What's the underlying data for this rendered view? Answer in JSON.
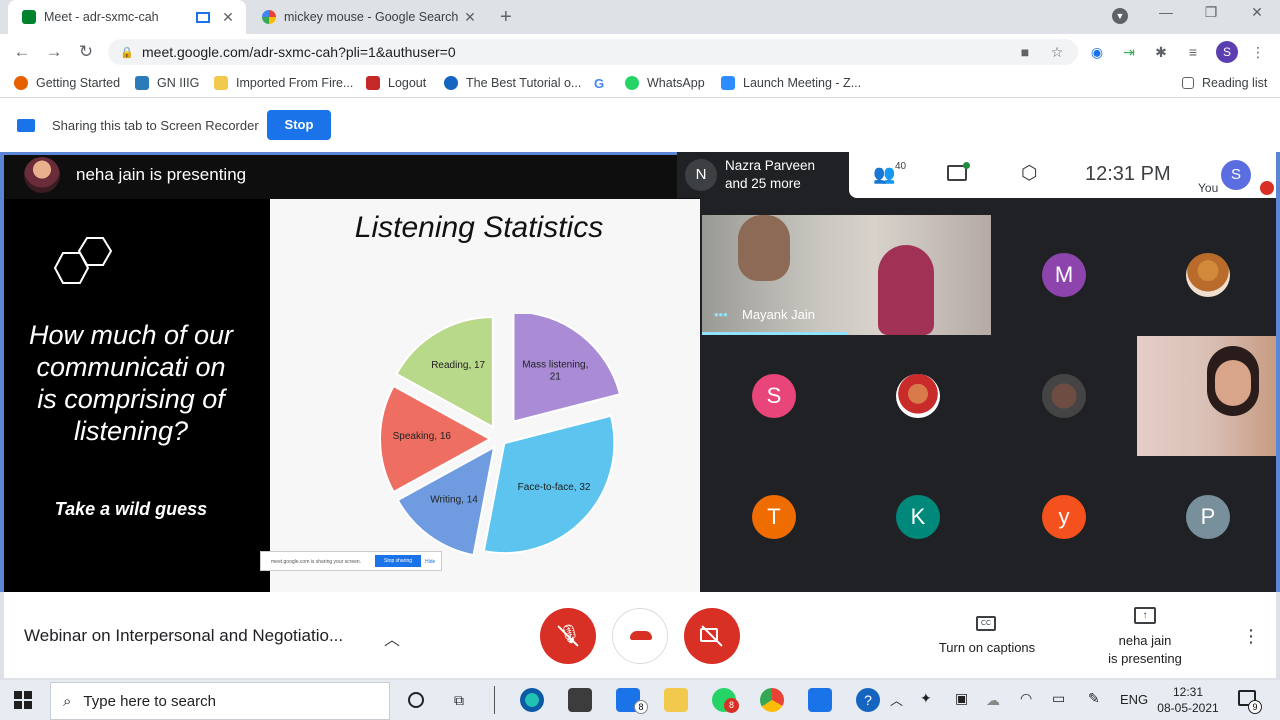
{
  "browser": {
    "tabs": [
      {
        "title": "Meet - adr-sxmc-cah",
        "active": true
      },
      {
        "title": "mickey mouse - Google Search",
        "active": false
      }
    ],
    "url": "meet.google.com/adr-sxmc-cah?pli=1&authuser=0",
    "profile_initial": "S",
    "bookmarks": [
      "Getting Started",
      "GN IIIG",
      "Imported From Fire...",
      "Logout",
      "The Best Tutorial o...",
      "WhatsApp",
      "Launch Meeting - Z..."
    ],
    "reading_list": "Reading list"
  },
  "share_bar": {
    "message": "Sharing this tab to Screen Recorder",
    "stop_label": "Stop"
  },
  "meet": {
    "presenter_banner": "neha jain is presenting",
    "participants_preview": {
      "initial": "N",
      "name": "Nazra Parveen",
      "more": "and 25 more"
    },
    "participant_count": "40",
    "time": "12:31 PM",
    "you_label": "You",
    "you_initial": "S",
    "tiles": {
      "video1_name": "Mayank Jain",
      "avatars": [
        {
          "initial": "M",
          "color": "#8e44ad"
        },
        {
          "initial": "S",
          "color": "#e8457a"
        },
        {
          "initial": "T",
          "color": "#ef6c00"
        },
        {
          "initial": "K",
          "color": "#00897b"
        },
        {
          "initial": "y",
          "color": "#f4511e"
        },
        {
          "initial": "P",
          "color": "#78909c"
        }
      ]
    },
    "slide": {
      "question": "How much of our communicati on is comprising of listening?",
      "tagline": "Take a wild guess",
      "title": "Listening Statistics",
      "share_notice": "meet.google.com is sharing your screen.",
      "share_notice_stop": "Stop sharing",
      "share_notice_hide": "Hide"
    },
    "meeting_title": "Webinar on Interpersonal and Negotiatio...",
    "captions_label": "Turn on captions",
    "presenting_label_1": "neha jain",
    "presenting_label_2": "is presenting"
  },
  "chart_data": {
    "type": "pie",
    "title": "Listening Statistics",
    "categories": [
      "Mass listening",
      "Face-to-face",
      "Writing",
      "Speaking",
      "Reading"
    ],
    "values": [
      21,
      32,
      14,
      16,
      17
    ],
    "labels": [
      "Mass listening, 21",
      "Face-to-face, 32",
      "Writing, 14",
      "Speaking, 16",
      "Reading, 17"
    ],
    "colors": [
      "#a98bd6",
      "#5cc4ef",
      "#6f9ce0",
      "#ef6e62",
      "#b9d98a"
    ]
  },
  "taskbar": {
    "search_placeholder": "Type here to search",
    "language": "ENG",
    "time": "12:31",
    "date": "08-05-2021",
    "notification_count": "9",
    "mail_badge": "8",
    "whatsapp_badge": "8"
  }
}
